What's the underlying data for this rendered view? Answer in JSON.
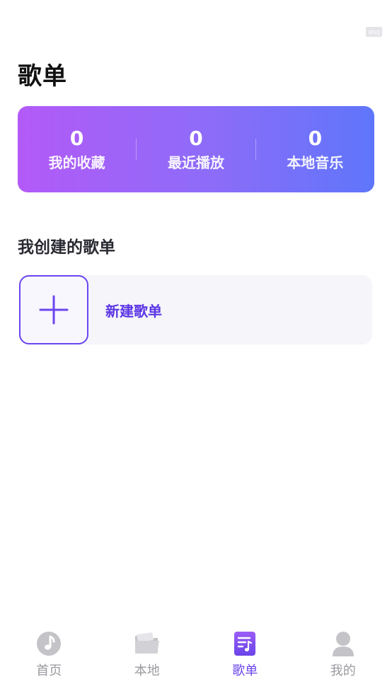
{
  "watermark": "aisg",
  "page": {
    "title": "歌单"
  },
  "stats": [
    {
      "value": "0",
      "label": "我的收藏"
    },
    {
      "value": "0",
      "label": "最近播放"
    },
    {
      "value": "0",
      "label": "本地音乐"
    }
  ],
  "section": {
    "title": "我创建的歌单"
  },
  "new_playlist": {
    "label": "新建歌单"
  },
  "tabs": [
    {
      "label": "首页",
      "icon": "music-note-icon",
      "active": false
    },
    {
      "label": "本地",
      "icon": "folder-icon",
      "active": false
    },
    {
      "label": "歌单",
      "icon": "playlist-icon",
      "active": true
    },
    {
      "label": "我的",
      "icon": "user-icon",
      "active": false
    }
  ],
  "colors": {
    "accent": "#6a45ea",
    "gradient_start": "#b35af8",
    "gradient_end": "#5e76fb",
    "inactive": "#9a9aa0"
  }
}
